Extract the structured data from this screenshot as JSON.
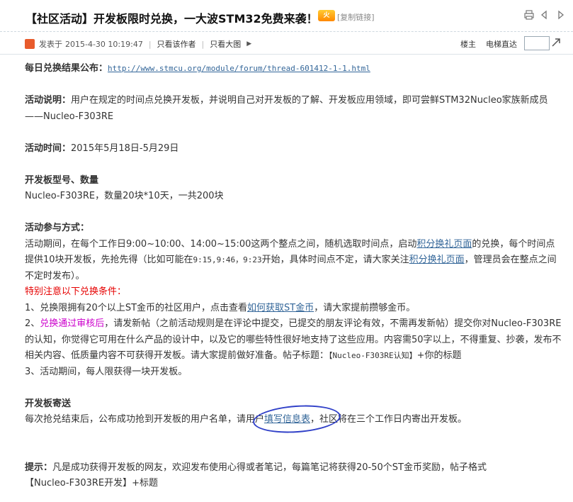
{
  "thread": {
    "title": "【社区活动】开发板限时兑换，一大波STM32免费来袭！",
    "hot_badge": "火",
    "copy_link": "[复制链接]"
  },
  "toolbar": {
    "icons": [
      "print-icon",
      "prev-thread-icon",
      "next-thread-icon"
    ]
  },
  "meta": {
    "posted_label": "发表于",
    "posted_time": "2015-4-30 10:19:47",
    "author_only": "只看该作者",
    "big_image": "只看大图",
    "floor_label": "楼主",
    "jump_label": "电梯直达",
    "jump_value": ""
  },
  "post": {
    "results_label": "每日兑换结果公布：",
    "results_url": "http://www.stmcu.org/module/forum/thread-601412-1-1.html",
    "desc_label": "活动说明：",
    "desc_text": "用户在规定的时间点兑换开发板，并说明自己对开发板的了解、开发板应用领域，即可尝鲜STM32Nucleo家族新成员——Nucleo-F303RE",
    "time_label": "活动时间：",
    "time_text": "2015年5月18日-5月29日",
    "model_heading": "开发板型号、数量",
    "model_text": "Nucleo-F303RE，数量20块*10天，一共200块",
    "method_heading": "活动参与方式：",
    "method_p1": "活动期间，在每个工作日9:00~10:00、14:00~15:00这两个整点之间，随机选取时间点，启动",
    "method_link1": "积分换礼页面",
    "method_p2": "的兑换，每个时间点提供10块开发板，先抢先得（比如可能在",
    "method_p2_mono": "9:15,9:46，9:23",
    "method_p3": "开始，具体时间点不定，请大家关注",
    "method_link2": "积分换礼页面",
    "method_p4": "，管理员会在整点之间不定时发布）。",
    "notice_heading": "特别注意以下兑换条件：",
    "cond1_pre": "1、兑换限拥有20个以上ST金币的社区用户，点击查看",
    "cond1_link": "如何获取ST金币",
    "cond1_post": "，请大家提前攒够金币。",
    "cond2_pre": "2、",
    "cond2_magenta": "兑换通过审核后",
    "cond2_text": "，请发新帖（之前活动规则是在评论中提交，已提交的朋友评论有效，不需再发新帖）提交你对Nucleo-F303RE的认知，你觉得它可用在什么产品的设计中，以及它的哪些特性很好地支持了这些应用。内容需50字以上，不得重复、抄袭，发布不相关内容、低质量内容不可获得开发板。请大家提前做好准备。帖子标题：",
    "cond2_mono": "【Nucleo-F303RE认知】",
    "cond2_tail": "+你的标题",
    "cond3": "3、活动期间，每人限获得一块开发板。",
    "ship_heading": "开发板寄送",
    "ship_pre": "每次抢兑结束后，公布成功抢到开发板的用户名单，请用户",
    "ship_link": "填写信息表",
    "ship_post": "，社区将在三个工作日内寄出开发板。",
    "tip_label": "提示：",
    "tip_text": "凡是成功获得开发板的网友，欢迎发布使用心得或者笔记，每篇笔记将获得20-50个ST金币奖励，帖子格式",
    "tip_tail": "【Nucleo-F303RE开发】+标题"
  }
}
